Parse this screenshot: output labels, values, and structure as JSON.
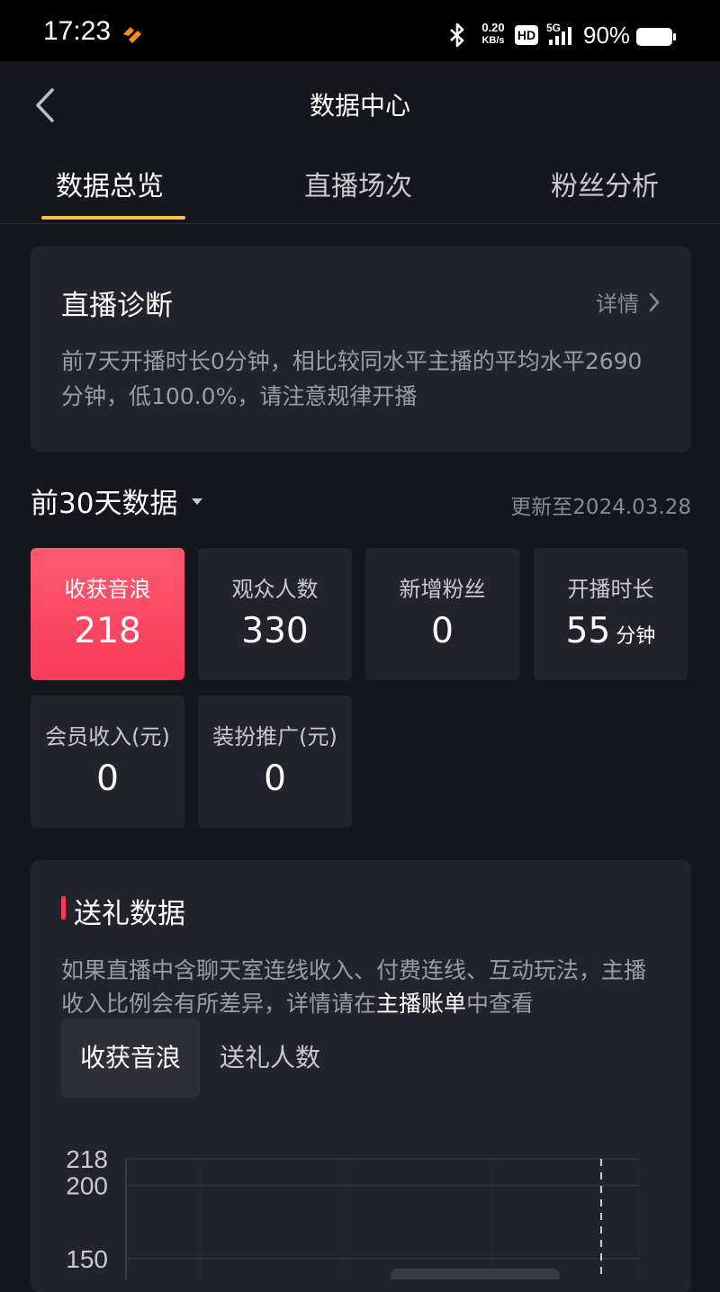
{
  "status_bar": {
    "time": "17:23",
    "net_speed_value": "0.20",
    "net_speed_unit": "KB/s",
    "hd_label": "HD",
    "network": "5G",
    "battery": "90%"
  },
  "header": {
    "title": "数据中心"
  },
  "tabs": [
    {
      "label": "数据总览",
      "active": true
    },
    {
      "label": "直播场次",
      "active": false
    },
    {
      "label": "粉丝分析",
      "active": false
    }
  ],
  "diagnosis": {
    "title": "直播诊断",
    "detail_label": "详情",
    "description": "前7天开播时长0分钟，相比较同水平主播的平均水平2690分钟，低100.0%，请注意规律开播"
  },
  "period": {
    "label": "前30天数据",
    "updated": "更新至2024.03.28"
  },
  "stats": [
    {
      "label": "收获音浪",
      "value": "218",
      "unit": "",
      "active": true
    },
    {
      "label": "观众人数",
      "value": "330",
      "unit": "",
      "active": false
    },
    {
      "label": "新增粉丝",
      "value": "0",
      "unit": "",
      "active": false
    },
    {
      "label": "开播时长",
      "value": "55",
      "unit": "分钟",
      "active": false
    },
    {
      "label": "会员收入(元)",
      "value": "0",
      "unit": "",
      "active": false
    },
    {
      "label": "装扮推广(元)",
      "value": "0",
      "unit": "",
      "active": false
    }
  ],
  "gift": {
    "title": "送礼数据",
    "desc_before": "如果直播中含聊天室连线收入、付费连线、互动玩法，主播收入比例会有所差异，详情请在",
    "desc_link": "主播账单",
    "desc_after": "中查看",
    "segments": [
      {
        "label": "收获音浪",
        "active": true
      },
      {
        "label": "送礼人数",
        "active": false
      }
    ]
  },
  "chart_data": {
    "type": "line",
    "y_ticks": [
      "218",
      "200",
      "150"
    ],
    "y_tick_values": [
      218,
      200,
      150
    ],
    "ylim": [
      150,
      218
    ],
    "grid": true,
    "accent": "#f83a58"
  },
  "colors": {
    "background": "#16161e",
    "card": "#23232d",
    "accent_red": "#f83a58",
    "tab_indicator": "#f5c242"
  }
}
